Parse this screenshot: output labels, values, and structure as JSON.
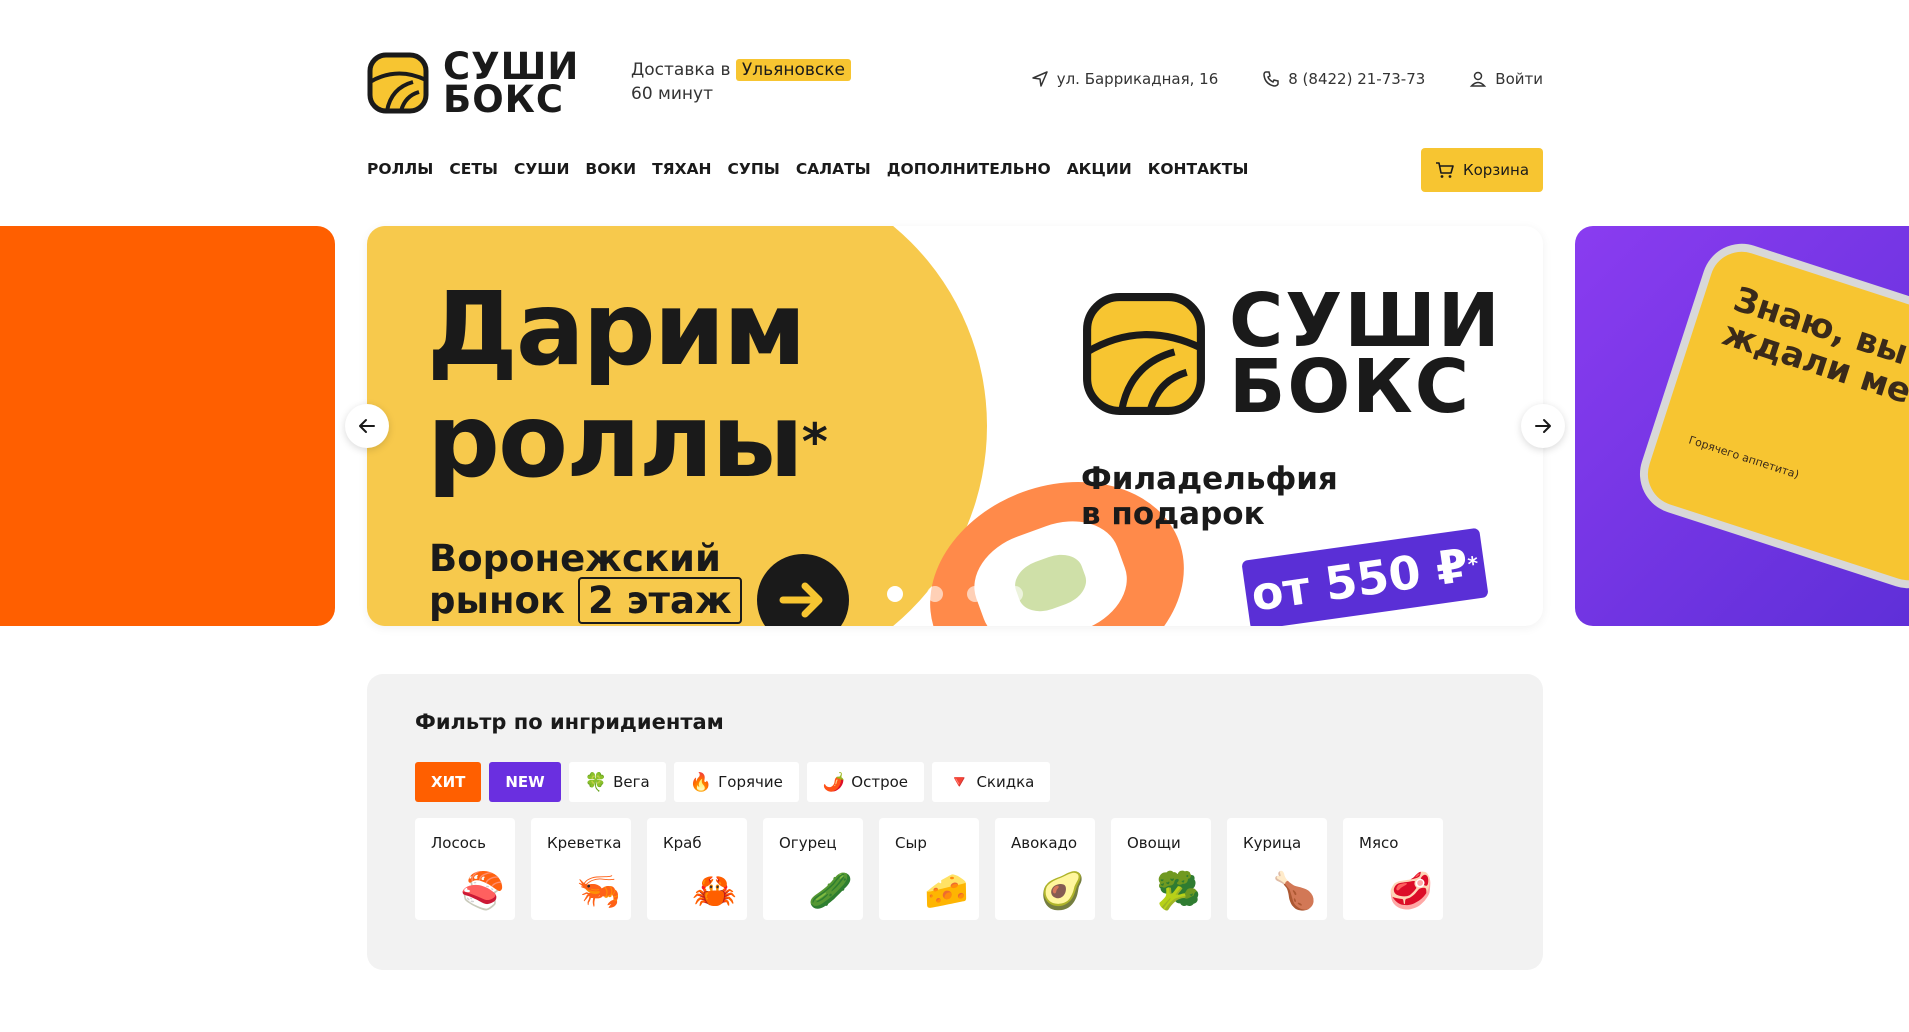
{
  "brand": {
    "logo_line1": "СУШИ",
    "logo_line2": "БОКС"
  },
  "header": {
    "delivery_prefix": "Доставка в",
    "city": "Ульяновске",
    "delivery_time": "60 минут",
    "address": "ул. Баррикадная, 16",
    "phone": "8 (8422) 21-73-73",
    "login": "Войти"
  },
  "nav": {
    "items": [
      "РОЛЛЫ",
      "СЕТЫ",
      "СУШИ",
      "ВОКИ",
      "ТЯХАН",
      "СУПЫ",
      "САЛАТЫ",
      "ДОПОЛНИТЕЛЬНО",
      "АКЦИИ",
      "КОНТАКТЫ"
    ],
    "cart": "Корзина"
  },
  "banner": {
    "title_line1": "Дарим",
    "title_line2": "роллы",
    "title_star": "*",
    "sub_line1": "Воронежский",
    "sub_line2": "рынок",
    "floor": "2 этаж",
    "brand_line1": "СУШИ",
    "brand_line2": "БОКС",
    "gift_line1": "Филадельфия",
    "gift_line2": "в подарок",
    "price": "от 550 ₽",
    "price_star": "*",
    "right_slide_text": "Знаю, вы ждали меня",
    "right_slide_small": "Горячего аппетита)",
    "dots_total": 4,
    "dot_active_index": 0
  },
  "filter": {
    "title": "Фильтр по ингридиентам",
    "tags": [
      {
        "label": "ХИТ",
        "icon": ""
      },
      {
        "label": "NEW",
        "icon": ""
      },
      {
        "label": "Вега",
        "icon": "clover-icon"
      },
      {
        "label": "Горячие",
        "icon": "fire-icon"
      },
      {
        "label": "Острое",
        "icon": "chili-icon"
      },
      {
        "label": "Скидка",
        "icon": "discount-icon"
      }
    ],
    "ingredients": [
      {
        "label": "Лосось",
        "icon": "salmon-icon"
      },
      {
        "label": "Креветка",
        "icon": "shrimp-icon"
      },
      {
        "label": "Краб",
        "icon": "crab-icon"
      },
      {
        "label": "Огурец",
        "icon": "cucumber-icon"
      },
      {
        "label": "Сыр",
        "icon": "cheese-icon"
      },
      {
        "label": "Авокадо",
        "icon": "avocado-icon"
      },
      {
        "label": "Овощи",
        "icon": "broccoli-icon"
      },
      {
        "label": "Курица",
        "icon": "chicken-icon"
      },
      {
        "label": "Мясо",
        "icon": "meat-icon"
      }
    ]
  },
  "colors": {
    "brand_yellow": "#f7c531",
    "hit_orange": "#ff5f00",
    "new_purple": "#6a2fe0",
    "panel_gray": "#f2f2f2"
  }
}
